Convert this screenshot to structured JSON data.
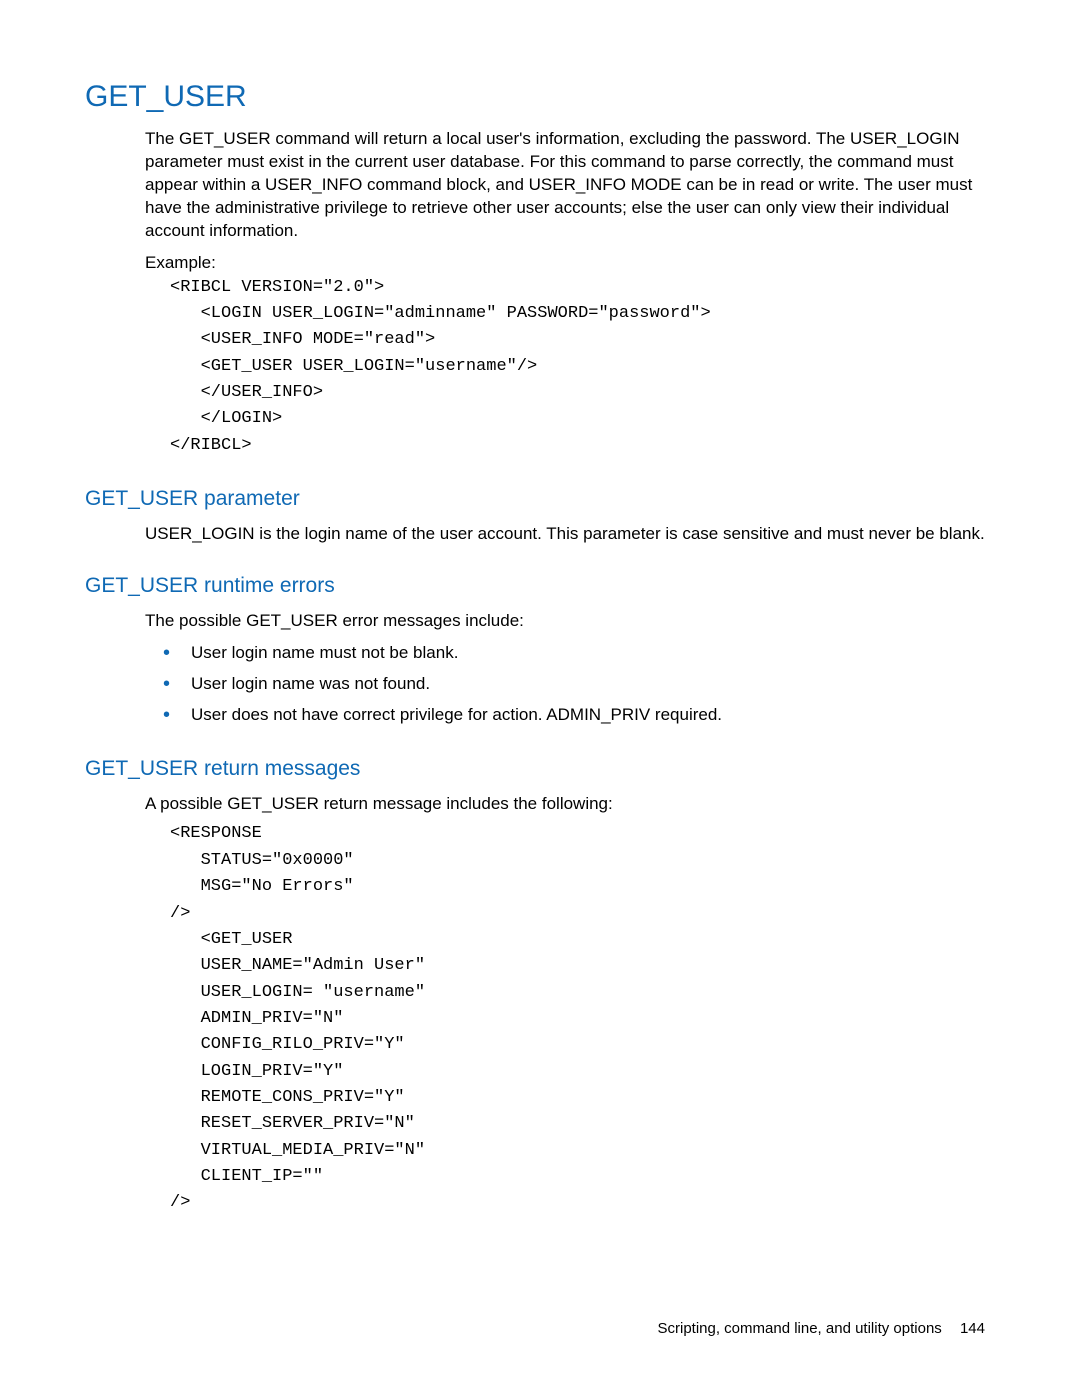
{
  "section": {
    "title": "GET_USER",
    "intro": "The GET_USER command will return a local user's information, excluding the password. The USER_LOGIN parameter must exist in the current user database. For this command to parse correctly, the command must appear within a USER_INFO command block, and USER_INFO MODE can be in read or write. The user must have the administrative privilege to retrieve other user accounts; else the user can only view their individual account information.",
    "example_label": "Example:",
    "example_lines": [
      "<RIBCL VERSION=\"2.0\">",
      "   <LOGIN USER_LOGIN=\"adminname\" PASSWORD=\"password\">",
      "   <USER_INFO MODE=\"read\">",
      "   <GET_USER USER_LOGIN=\"username\"/>",
      "   </USER_INFO>",
      "   </LOGIN>",
      "</RIBCL>"
    ]
  },
  "parameter": {
    "heading": "GET_USER parameter",
    "text": "USER_LOGIN is the login name of the user account. This parameter is case sensitive and must never be blank."
  },
  "runtime": {
    "heading": "GET_USER runtime errors",
    "intro": "The possible GET_USER error messages include:",
    "items": [
      "User login name must not be blank.",
      "User login name was not found.",
      "User does not have correct privilege for action. ADMIN_PRIV required."
    ]
  },
  "return_msgs": {
    "heading": "GET_USER return messages",
    "intro": "A possible GET_USER return message includes the following:",
    "code_lines": [
      "<RESPONSE",
      "   STATUS=\"0x0000\"",
      "   MSG=\"No Errors\"",
      "/>",
      "   <GET_USER",
      "   USER_NAME=\"Admin User\"",
      "   USER_LOGIN= \"username\"",
      "   ADMIN_PRIV=\"N\"",
      "   CONFIG_RILO_PRIV=\"Y\"",
      "   LOGIN_PRIV=\"Y\"",
      "   REMOTE_CONS_PRIV=\"Y\"",
      "   RESET_SERVER_PRIV=\"N\"",
      "   VIRTUAL_MEDIA_PRIV=\"N\"",
      "   CLIENT_IP=\"\"",
      "/>"
    ]
  },
  "footer": {
    "text": "Scripting, command line, and utility options",
    "page": "144"
  }
}
